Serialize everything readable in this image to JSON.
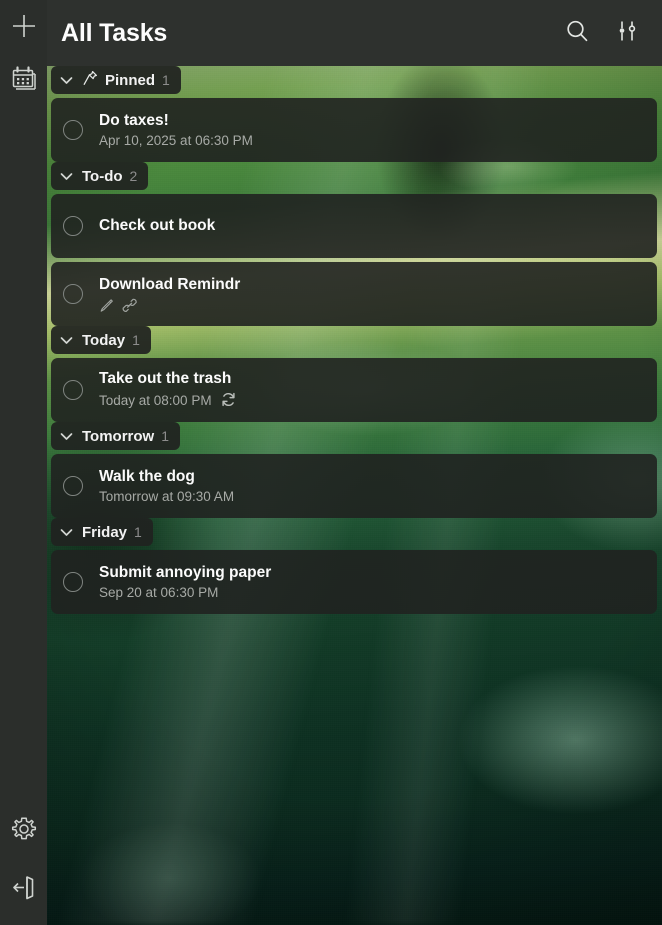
{
  "app": {
    "title": "All Tasks",
    "accent_color": "#2b2e2b",
    "header_bg": "#2e312e",
    "card_bg": "#202220"
  },
  "sidebar": {
    "top_items": [
      {
        "name": "add-task-button",
        "icon": "plus-icon",
        "label": ""
      },
      {
        "name": "calendar-button",
        "icon": "calendar-icon",
        "label": ""
      }
    ],
    "bottom_items": [
      {
        "name": "settings-button",
        "icon": "gear-icon",
        "label": ""
      },
      {
        "name": "logout-button",
        "icon": "logout-icon",
        "label": ""
      }
    ]
  },
  "header": {
    "title": "All Tasks",
    "actions": [
      {
        "name": "search-button",
        "icon": "search-icon"
      },
      {
        "name": "filter-button",
        "icon": "sliders-icon"
      }
    ]
  },
  "groups": [
    {
      "id": "pinned",
      "label": "Pinned",
      "count": "1",
      "has_pin_icon": true,
      "expanded": true,
      "tasks": [
        {
          "title": "Do taxes!",
          "subtitle": "Apr 10, 2025 at 06:30 PM",
          "recurring": false,
          "icons": []
        }
      ]
    },
    {
      "id": "to-do",
      "label": "To-do",
      "count": "2",
      "has_pin_icon": false,
      "expanded": true,
      "tasks": [
        {
          "title": "Check out book",
          "subtitle": "",
          "recurring": false,
          "icons": []
        },
        {
          "title": "Download Remindr",
          "subtitle": "",
          "recurring": false,
          "icons": [
            "pencil-icon",
            "link-icon"
          ]
        }
      ]
    },
    {
      "id": "today",
      "label": "Today",
      "count": "1",
      "has_pin_icon": false,
      "expanded": true,
      "tasks": [
        {
          "title": "Take out the trash",
          "subtitle": "Today at 08:00 PM",
          "recurring": true,
          "icons": []
        }
      ]
    },
    {
      "id": "tomorrow",
      "label": "Tomorrow",
      "count": "1",
      "has_pin_icon": false,
      "expanded": true,
      "tasks": [
        {
          "title": "Walk the dog",
          "subtitle": "Tomorrow at 09:30 AM",
          "recurring": false,
          "icons": []
        }
      ]
    },
    {
      "id": "friday",
      "label": "Friday",
      "count": "1",
      "has_pin_icon": false,
      "expanded": true,
      "tasks": [
        {
          "title": "Submit annoying paper",
          "subtitle": "Sep 20 at 06:30 PM",
          "recurring": false,
          "icons": []
        }
      ]
    }
  ]
}
